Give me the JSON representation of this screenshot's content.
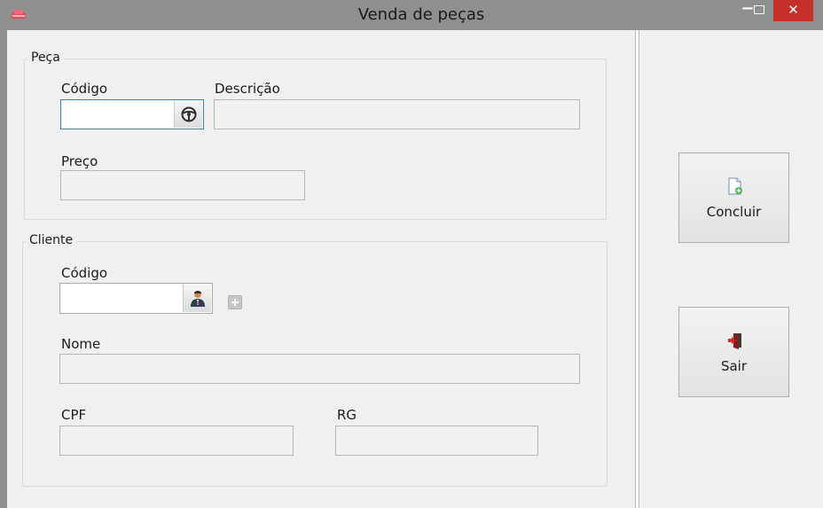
{
  "window": {
    "title": "Venda de peças",
    "minimize_glyph": "−",
    "close_glyph": "✕"
  },
  "peca": {
    "group_label": "Peça",
    "codigo_label": "Código",
    "codigo_value": "",
    "codigo_button_icon": "steering-wheel-icon",
    "descricao_label": "Descrição",
    "descricao_value": "",
    "preco_label": "Preço",
    "preco_value": ""
  },
  "cliente": {
    "group_label": "Cliente",
    "codigo_label": "Código",
    "codigo_value": "",
    "codigo_button_icon": "person-icon",
    "add_button_icon": "plus-icon",
    "nome_label": "Nome",
    "nome_value": "",
    "cpf_label": "CPF",
    "cpf_value": "",
    "rg_label": "RG",
    "rg_value": ""
  },
  "actions": {
    "concluir_label": "Concluir",
    "concluir_icon": "document-add-icon",
    "sair_label": "Sair",
    "sair_icon": "exit-door-icon"
  },
  "colors": {
    "titlebar": "#8f8f8f",
    "close_button": "#c7302a",
    "window_bg": "#f0f0f0",
    "active_field_border": "#3c7fb1"
  }
}
